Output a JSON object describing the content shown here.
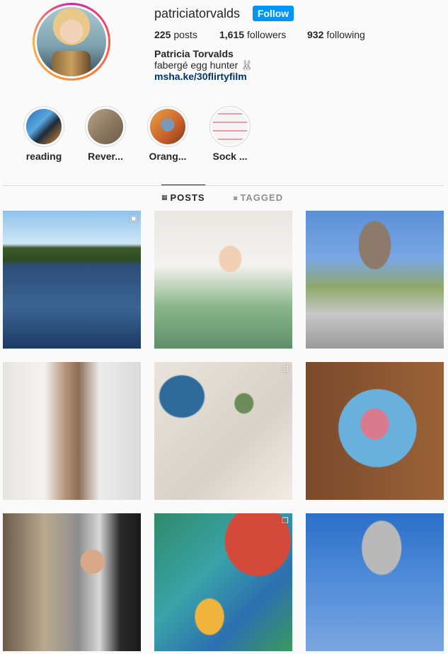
{
  "profile": {
    "username": "patriciatorvalds",
    "follow_label": "Follow",
    "stats": {
      "posts_count": "225",
      "posts_label": "posts",
      "followers_count": "1,615",
      "followers_label": "followers",
      "following_count": "932",
      "following_label": "following"
    },
    "full_name": "Patricia Torvalds",
    "bio": "fabergé egg hunter 🐰",
    "link": "msha.ke/30flirtyfilm"
  },
  "highlights": [
    {
      "label": "reading"
    },
    {
      "label": "Rever..."
    },
    {
      "label": "Orang..."
    },
    {
      "label": "Sock ..."
    }
  ],
  "tabs": {
    "posts": {
      "label": "POSTS",
      "icon": "grid-icon",
      "active": true
    },
    "tagged": {
      "label": "TAGGED",
      "icon": "tag-icon",
      "active": false
    }
  },
  "posts": [
    {
      "index": 1,
      "overlay_icon": "reel-icon"
    },
    {
      "index": 2
    },
    {
      "index": 3
    },
    {
      "index": 4
    },
    {
      "index": 5,
      "overlay_icon": "carousel-icon"
    },
    {
      "index": 6
    },
    {
      "index": 7
    },
    {
      "index": 8,
      "overlay_icon": "carousel-icon"
    },
    {
      "index": 9
    }
  ],
  "colors": {
    "follow_button": "#0095f6",
    "link": "#00376b",
    "text": "#262626",
    "muted": "#8e8e8e",
    "divider": "#dbdbdb",
    "background": "#fafafa"
  }
}
